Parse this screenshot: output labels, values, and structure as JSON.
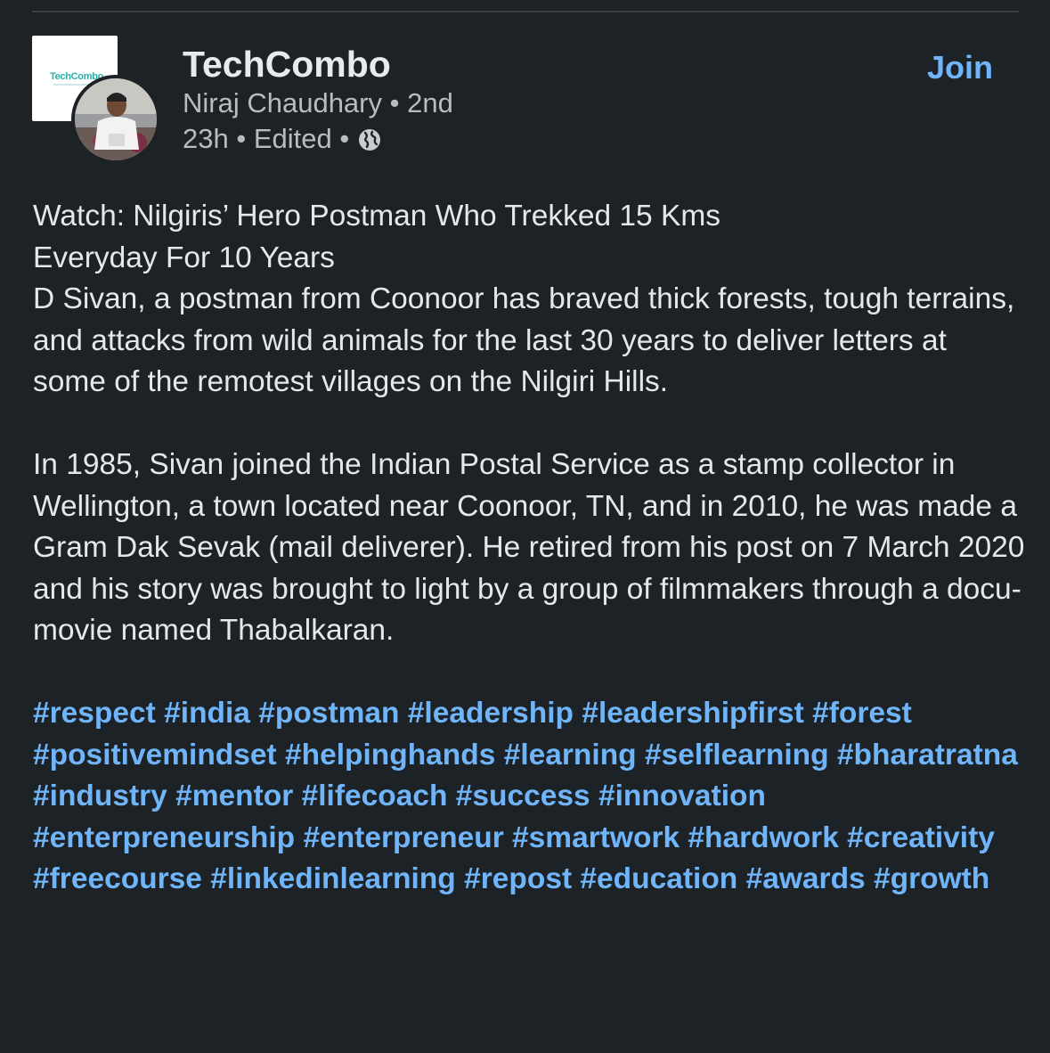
{
  "group": {
    "name": "TechCombo",
    "logo_text": "TechCombo"
  },
  "author": {
    "name": "Niraj Chaudhary",
    "separator": "•",
    "degree": "2nd"
  },
  "post_meta": {
    "time": "23h",
    "separator": "•",
    "edited": "Edited",
    "visibility_icon": "globe-icon"
  },
  "actions": {
    "join_label": "Join"
  },
  "post": {
    "title_line1": "Watch: Nilgiris’ Hero Postman Who Trekked 15 Kms",
    "title_line2": "Everyday For 10 Years",
    "paragraph1": "D Sivan, a postman from Coonoor has braved thick forests, tough terrains, and attacks from wild animals for the last 30 years to deliver letters at some of the remotest villages on the Nilgiri Hills.",
    "paragraph2": "In 1985, Sivan joined the Indian Postal Service as a stamp collector in Wellington, a town located near Coonoor, TN, and in 2010, he was made a Gram Dak Sevak (mail deliverer). He retired from his post on 7 March 2020 and his story was brought to light by a group of filmmakers through a docu-movie named Thabalkaran.",
    "hashtags": [
      "#respect",
      "#india",
      "#postman",
      "#leadership",
      "#leadershipfirst",
      "#forest",
      "#positivemindset",
      "#helpinghands",
      "#learning",
      "#selflearning",
      "#bharatratna",
      "#industry",
      "#mentor",
      "#lifecoach",
      "#success",
      "#innovation",
      "#enterpreneurship",
      "#enterpreneur",
      "#smartwork",
      "#hardwork",
      "#creativity",
      "#freecourse",
      "#linkedinlearning",
      "#repost",
      "#education",
      "#awards",
      "#growth"
    ]
  },
  "colors": {
    "background": "#1d2226",
    "link": "#70b5f9",
    "primary_text": "#e6e7e8",
    "secondary_text": "#b9bcbf"
  }
}
